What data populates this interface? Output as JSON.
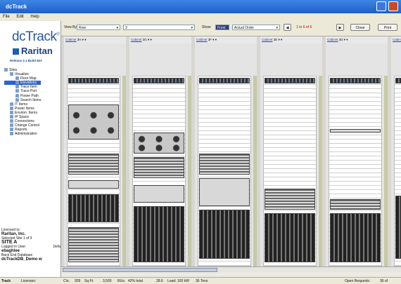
{
  "window": {
    "title": "dcTrack"
  },
  "menu": [
    "File",
    "Edit",
    "Help"
  ],
  "sidebar": {
    "logo": "dcTrack",
    "logo_tm": "®",
    "brand": "Raritan",
    "release": "Release 2.1 Build 822",
    "tree": [
      {
        "label": "Sites",
        "level": 0
      },
      {
        "label": "Visualize",
        "level": 1
      },
      {
        "label": "Floor Map",
        "level": 2
      },
      {
        "label": "Elevations",
        "level": 2,
        "selected": true
      },
      {
        "label": "Trace Item",
        "level": 2
      },
      {
        "label": "Trace Port",
        "level": 2
      },
      {
        "label": "Power Path",
        "level": 2
      },
      {
        "label": "Search Items",
        "level": 2
      },
      {
        "label": "IT Items",
        "level": 1
      },
      {
        "label": "Power Items",
        "level": 1
      },
      {
        "label": "Environ. Items",
        "level": 1
      },
      {
        "label": "IP Space",
        "level": 1
      },
      {
        "label": "Connections",
        "level": 1
      },
      {
        "label": "Change Control",
        "level": 1
      },
      {
        "label": "Reports",
        "level": 1
      },
      {
        "label": "Administration",
        "level": 1
      }
    ],
    "license": {
      "licensed_to_label": "Licensed to:",
      "company": "Raritan, Inc.",
      "selected_site": "Selected Site 1 of 3",
      "site": "SITE A",
      "logged_in": "Logged in User:",
      "logged_in_right": "Defa",
      "user": "ebaghlee",
      "backend_label": "Back End Database",
      "backend": "dcTrackDB_Demo w"
    }
  },
  "toolbar": {
    "view_by_label": "View By:",
    "view_by_value": "Row",
    "row_value": "3",
    "show_label": "Show",
    "show_value": "Front",
    "order_value": "Actual Order",
    "page_text": "1 to 6 of 6",
    "close": "Close",
    "print": "Print"
  },
  "racks": [
    {
      "label": "Cabinet",
      "name": "3H"
    },
    {
      "label": "Cabinet",
      "name": "3G"
    },
    {
      "label": "Cabinet",
      "name": "3F"
    },
    {
      "label": "Cabinet",
      "name": "3E"
    },
    {
      "label": "Cabinet",
      "name": "3D"
    },
    {
      "label": "Cabinet",
      "name": "3C"
    }
  ],
  "status": {
    "app": "Track",
    "licenses": "Licenses:",
    "cis": "CIs:",
    "cis_value": "929",
    "sqft": "Sq Ft:",
    "sqft_value": "3,500",
    "rus": "RUs:",
    "ru_pct": "42% total",
    "mid": "28.6",
    "load": "Load: 100 kW",
    "tons": "36 Tons",
    "open_requests": "Open Requests:",
    "open_value": "36 of"
  }
}
